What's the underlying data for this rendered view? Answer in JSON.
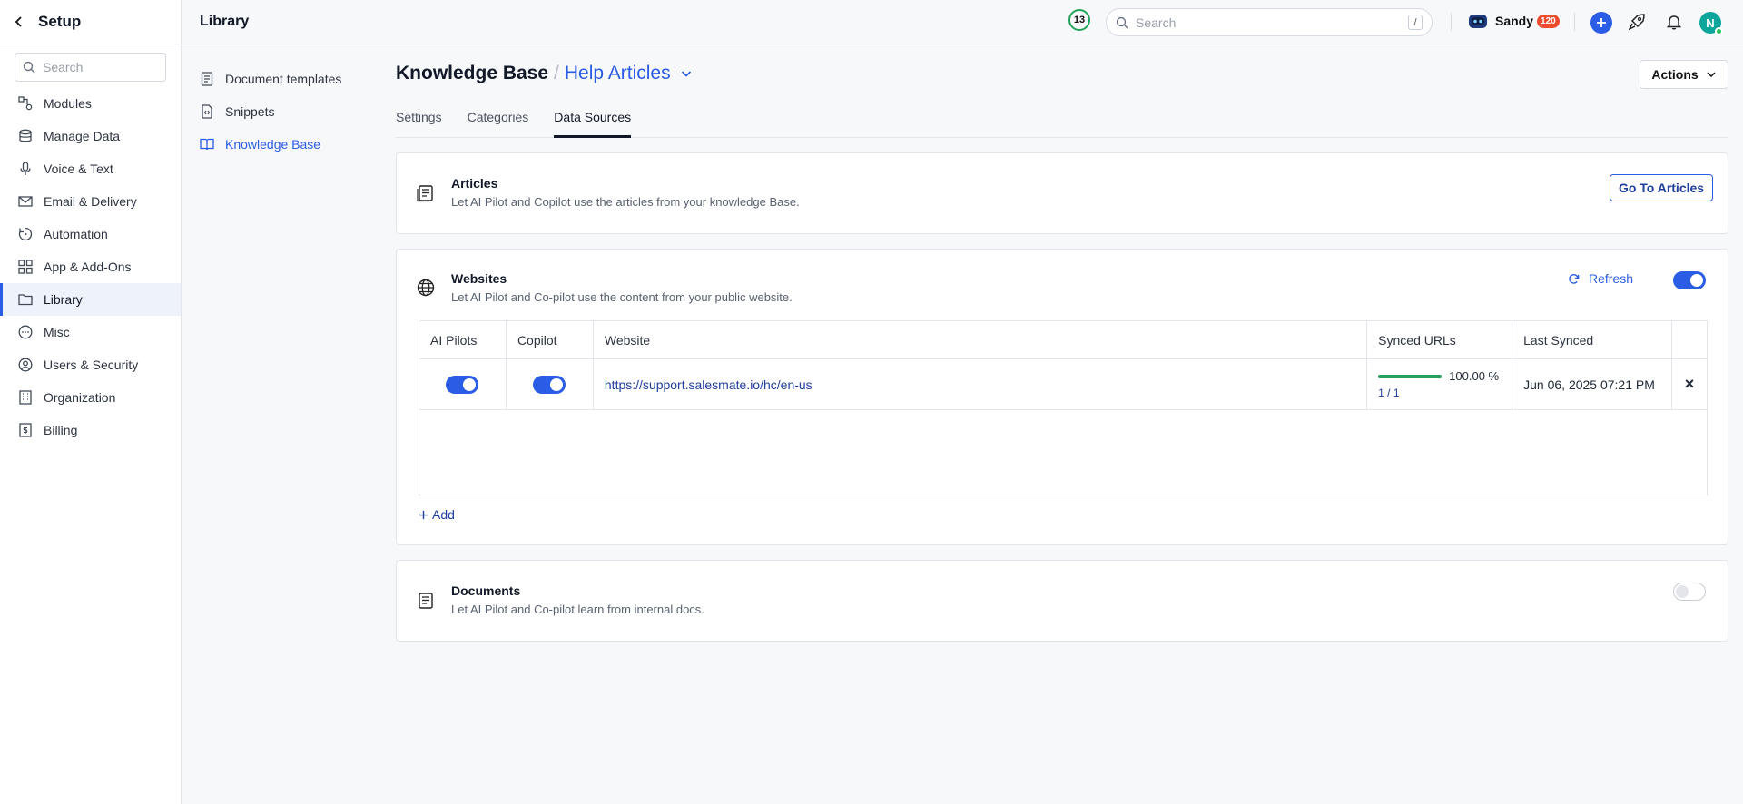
{
  "setup": {
    "title": "Setup",
    "search_placeholder": "Search",
    "items": [
      {
        "label": "Modules",
        "icon": "modules-icon"
      },
      {
        "label": "Manage Data",
        "icon": "database-icon"
      },
      {
        "label": "Voice & Text",
        "icon": "microphone-icon"
      },
      {
        "label": "Email & Delivery",
        "icon": "mail-icon"
      },
      {
        "label": "Automation",
        "icon": "automation-icon"
      },
      {
        "label": "App & Add-Ons",
        "icon": "grid-icon"
      },
      {
        "label": "Library",
        "icon": "folder-icon",
        "active": true
      },
      {
        "label": "Misc",
        "icon": "more-circle-icon"
      },
      {
        "label": "Users & Security",
        "icon": "user-circle-icon"
      },
      {
        "label": "Organization",
        "icon": "building-icon"
      },
      {
        "label": "Billing",
        "icon": "billing-icon"
      }
    ]
  },
  "library": {
    "title": "Library",
    "items": [
      {
        "label": "Document templates",
        "icon": "document-icon"
      },
      {
        "label": "Snippets",
        "icon": "code-file-icon"
      },
      {
        "label": "Knowledge Base",
        "icon": "book-icon",
        "active": true
      }
    ]
  },
  "topbar": {
    "notification_count": "13",
    "search_placeholder": "Search",
    "search_shortcut": "/",
    "user_name": "Sandy",
    "user_badge": "120",
    "avatar_initial": "N"
  },
  "header": {
    "breadcrumb_root": "Knowledge Base",
    "breadcrumb_separator": "/",
    "breadcrumb_current": "Help Articles",
    "actions_label": "Actions"
  },
  "tabs": [
    {
      "label": "Settings"
    },
    {
      "label": "Categories"
    },
    {
      "label": "Data Sources",
      "active": true
    }
  ],
  "articles": {
    "title": "Articles",
    "description": "Let AI Pilot and Copilot use the articles from your knowledge Base.",
    "button_label": "Go To Articles"
  },
  "websites": {
    "title": "Websites",
    "description": "Let AI Pilot and Co-pilot use the content from your public website.",
    "refresh_label": "Refresh",
    "enabled": true,
    "columns": [
      "AI Pilots",
      "Copilot",
      "Website",
      "Synced URLs",
      "Last Synced"
    ],
    "rows": [
      {
        "ai_pilots": true,
        "copilot": true,
        "website": "https://support.salesmate.io/hc/en-us",
        "sync_percent": 100,
        "sync_percent_label": "100.00 %",
        "sync_count": "1 / 1",
        "last_synced": "Jun 06, 2025 07:21 PM",
        "remove_label": "×"
      }
    ],
    "add_label": "Add"
  },
  "documents": {
    "title": "Documents",
    "description": "Let AI Pilot and Co-pilot learn from internal docs.",
    "enabled": false
  },
  "colors": {
    "accent": "#2b5ce6",
    "success": "#22a35a",
    "badge": "#ef4c2f"
  }
}
